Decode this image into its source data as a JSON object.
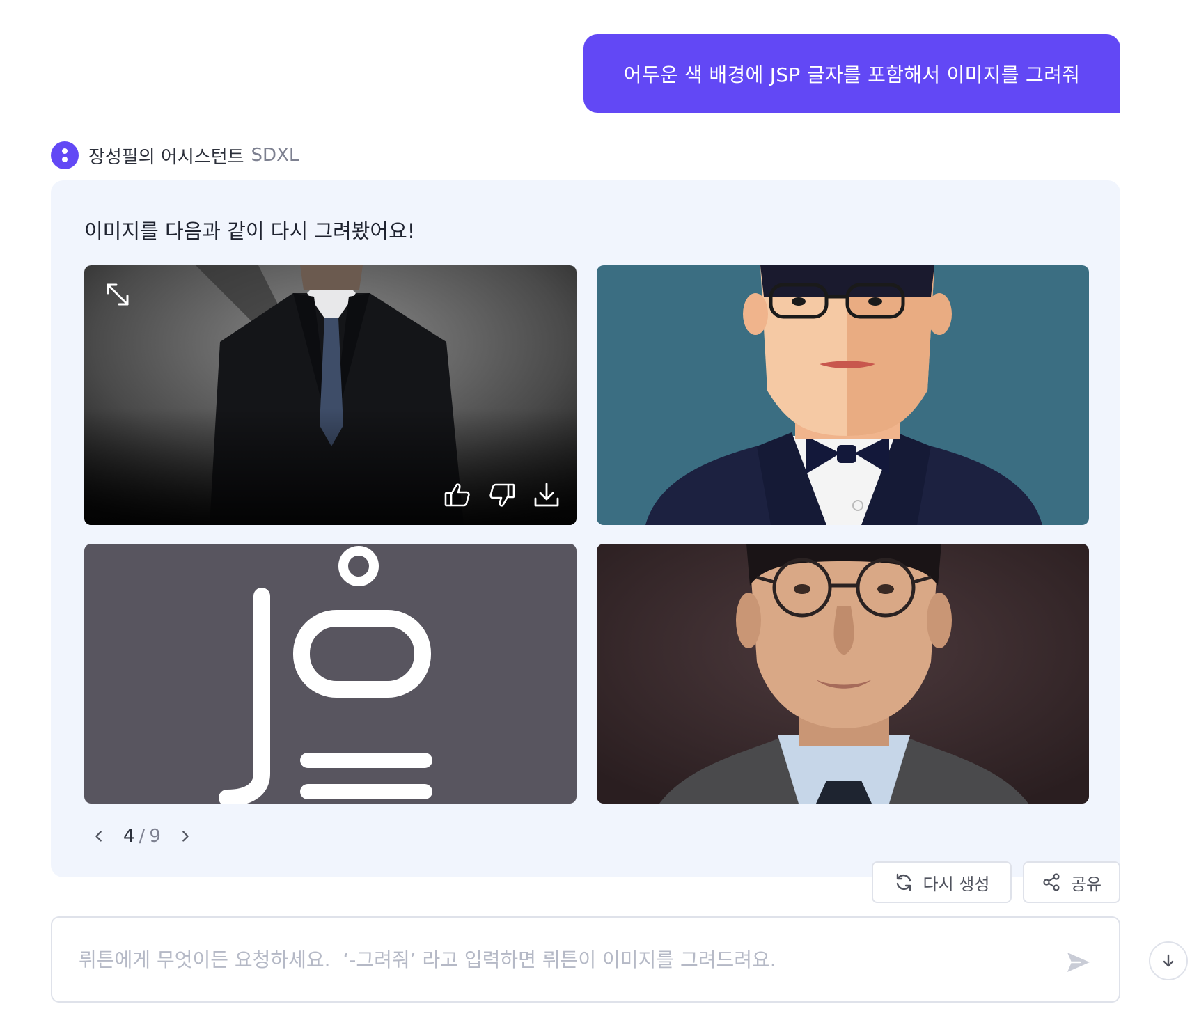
{
  "user_message": {
    "text": "어두운 색 배경에 JSP 글자를 포함해서 이미지를 그려줘"
  },
  "assistant": {
    "name": "장성필의 어시스턴트",
    "model": "SDXL",
    "response_text": "이미지를 다음과 같이 다시 그려봤어요!"
  },
  "images": [
    {
      "subject": "man in dark suit and tie against dark grey wall",
      "icon": "expand-icon"
    },
    {
      "subject": "illustrated man with glasses and bow tie on teal background"
    },
    {
      "subject": "abstract white letterforms on dark grey background"
    },
    {
      "subject": "portrait of man with round glasses on maroon background"
    }
  ],
  "image_actions": {
    "like_icon": "thumbs-up-icon",
    "dislike_icon": "thumbs-down-icon",
    "download_icon": "download-icon"
  },
  "pagination": {
    "current": "4",
    "separator": "/",
    "total": "9"
  },
  "buttons": {
    "regenerate": "다시 생성",
    "share": "공유"
  },
  "input": {
    "placeholder": "뤼튼에게 무엇이든 요청하세요.  ‘-그려줘’ 라고 입력하면 뤼튼이 이미지를 그려드려요.",
    "value": ""
  },
  "colors": {
    "accent": "#6248f5",
    "card_background": "#f1f5fd",
    "border": "#dfe2ea"
  }
}
